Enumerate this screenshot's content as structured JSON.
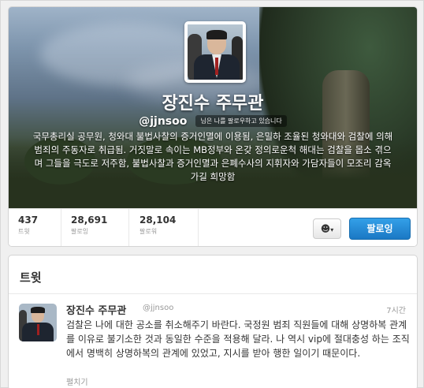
{
  "profile": {
    "name": "장진수 주무관",
    "handle": "@jjnsoo",
    "follows_you_badge": "님은 나를 팔로우하고 있습니다",
    "bio": "국무총리실 공무원, 청와대 불법사찰의 증거인멸에 이용됨, 은밀하 조율된 청와대와 검찰에 의해 범죄의 주동자로 취급됨. 거짓말로 속이는 MB정부와 온갖 정의로운척 해대는 검찰을 몹소 겪으며 그들을 극도로 저주함, 불법사찰과 증거인멸과 은폐수사의 지휘자와 가담자들이 모조리 감옥가길 희망함"
  },
  "stats": [
    {
      "value": "437",
      "label": "트윗"
    },
    {
      "value": "28,691",
      "label": "팔로잉"
    },
    {
      "value": "28,104",
      "label": "팔로워"
    }
  ],
  "actions": {
    "user_menu_icon": "person-icon",
    "follow_label": "팔로잉"
  },
  "tweets_section": {
    "title": "트윗",
    "items": [
      {
        "name": "장진수 주무관",
        "handle": "@jjnsoo",
        "time": "7시간",
        "text": "검찰은 나에 대한 공소를 취소해주기 바란다. 국정원 범죄 직원들에 대해 상명하복 관계를 이유로 불기소한 것과 동일한 수준을 적용해 달라. 나 역시 vip에 절대충성 하는 조직에서 명백히 상명하복의 관계에 있었고, 지시를 받아 행한 일이기 때문이다.",
        "expand_label": "펼치기"
      }
    ]
  },
  "colors": {
    "follow_button": "#1b78c4",
    "text_primary": "#333333",
    "text_muted": "#999999"
  }
}
